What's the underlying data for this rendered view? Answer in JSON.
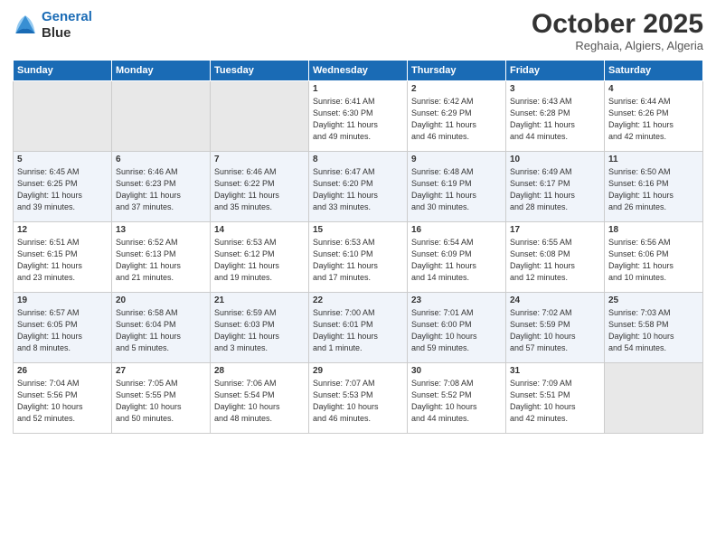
{
  "header": {
    "logo_line1": "General",
    "logo_line2": "Blue",
    "month": "October 2025",
    "location": "Reghaia, Algiers, Algeria"
  },
  "days_of_week": [
    "Sunday",
    "Monday",
    "Tuesday",
    "Wednesday",
    "Thursday",
    "Friday",
    "Saturday"
  ],
  "weeks": [
    [
      {
        "day": "",
        "content": ""
      },
      {
        "day": "",
        "content": ""
      },
      {
        "day": "",
        "content": ""
      },
      {
        "day": "1",
        "content": "Sunrise: 6:41 AM\nSunset: 6:30 PM\nDaylight: 11 hours\nand 49 minutes."
      },
      {
        "day": "2",
        "content": "Sunrise: 6:42 AM\nSunset: 6:29 PM\nDaylight: 11 hours\nand 46 minutes."
      },
      {
        "day": "3",
        "content": "Sunrise: 6:43 AM\nSunset: 6:28 PM\nDaylight: 11 hours\nand 44 minutes."
      },
      {
        "day": "4",
        "content": "Sunrise: 6:44 AM\nSunset: 6:26 PM\nDaylight: 11 hours\nand 42 minutes."
      }
    ],
    [
      {
        "day": "5",
        "content": "Sunrise: 6:45 AM\nSunset: 6:25 PM\nDaylight: 11 hours\nand 39 minutes."
      },
      {
        "day": "6",
        "content": "Sunrise: 6:46 AM\nSunset: 6:23 PM\nDaylight: 11 hours\nand 37 minutes."
      },
      {
        "day": "7",
        "content": "Sunrise: 6:46 AM\nSunset: 6:22 PM\nDaylight: 11 hours\nand 35 minutes."
      },
      {
        "day": "8",
        "content": "Sunrise: 6:47 AM\nSunset: 6:20 PM\nDaylight: 11 hours\nand 33 minutes."
      },
      {
        "day": "9",
        "content": "Sunrise: 6:48 AM\nSunset: 6:19 PM\nDaylight: 11 hours\nand 30 minutes."
      },
      {
        "day": "10",
        "content": "Sunrise: 6:49 AM\nSunset: 6:17 PM\nDaylight: 11 hours\nand 28 minutes."
      },
      {
        "day": "11",
        "content": "Sunrise: 6:50 AM\nSunset: 6:16 PM\nDaylight: 11 hours\nand 26 minutes."
      }
    ],
    [
      {
        "day": "12",
        "content": "Sunrise: 6:51 AM\nSunset: 6:15 PM\nDaylight: 11 hours\nand 23 minutes."
      },
      {
        "day": "13",
        "content": "Sunrise: 6:52 AM\nSunset: 6:13 PM\nDaylight: 11 hours\nand 21 minutes."
      },
      {
        "day": "14",
        "content": "Sunrise: 6:53 AM\nSunset: 6:12 PM\nDaylight: 11 hours\nand 19 minutes."
      },
      {
        "day": "15",
        "content": "Sunrise: 6:53 AM\nSunset: 6:10 PM\nDaylight: 11 hours\nand 17 minutes."
      },
      {
        "day": "16",
        "content": "Sunrise: 6:54 AM\nSunset: 6:09 PM\nDaylight: 11 hours\nand 14 minutes."
      },
      {
        "day": "17",
        "content": "Sunrise: 6:55 AM\nSunset: 6:08 PM\nDaylight: 11 hours\nand 12 minutes."
      },
      {
        "day": "18",
        "content": "Sunrise: 6:56 AM\nSunset: 6:06 PM\nDaylight: 11 hours\nand 10 minutes."
      }
    ],
    [
      {
        "day": "19",
        "content": "Sunrise: 6:57 AM\nSunset: 6:05 PM\nDaylight: 11 hours\nand 8 minutes."
      },
      {
        "day": "20",
        "content": "Sunrise: 6:58 AM\nSunset: 6:04 PM\nDaylight: 11 hours\nand 5 minutes."
      },
      {
        "day": "21",
        "content": "Sunrise: 6:59 AM\nSunset: 6:03 PM\nDaylight: 11 hours\nand 3 minutes."
      },
      {
        "day": "22",
        "content": "Sunrise: 7:00 AM\nSunset: 6:01 PM\nDaylight: 11 hours\nand 1 minute."
      },
      {
        "day": "23",
        "content": "Sunrise: 7:01 AM\nSunset: 6:00 PM\nDaylight: 10 hours\nand 59 minutes."
      },
      {
        "day": "24",
        "content": "Sunrise: 7:02 AM\nSunset: 5:59 PM\nDaylight: 10 hours\nand 57 minutes."
      },
      {
        "day": "25",
        "content": "Sunrise: 7:03 AM\nSunset: 5:58 PM\nDaylight: 10 hours\nand 54 minutes."
      }
    ],
    [
      {
        "day": "26",
        "content": "Sunrise: 7:04 AM\nSunset: 5:56 PM\nDaylight: 10 hours\nand 52 minutes."
      },
      {
        "day": "27",
        "content": "Sunrise: 7:05 AM\nSunset: 5:55 PM\nDaylight: 10 hours\nand 50 minutes."
      },
      {
        "day": "28",
        "content": "Sunrise: 7:06 AM\nSunset: 5:54 PM\nDaylight: 10 hours\nand 48 minutes."
      },
      {
        "day": "29",
        "content": "Sunrise: 7:07 AM\nSunset: 5:53 PM\nDaylight: 10 hours\nand 46 minutes."
      },
      {
        "day": "30",
        "content": "Sunrise: 7:08 AM\nSunset: 5:52 PM\nDaylight: 10 hours\nand 44 minutes."
      },
      {
        "day": "31",
        "content": "Sunrise: 7:09 AM\nSunset: 5:51 PM\nDaylight: 10 hours\nand 42 minutes."
      },
      {
        "day": "",
        "content": ""
      }
    ]
  ]
}
